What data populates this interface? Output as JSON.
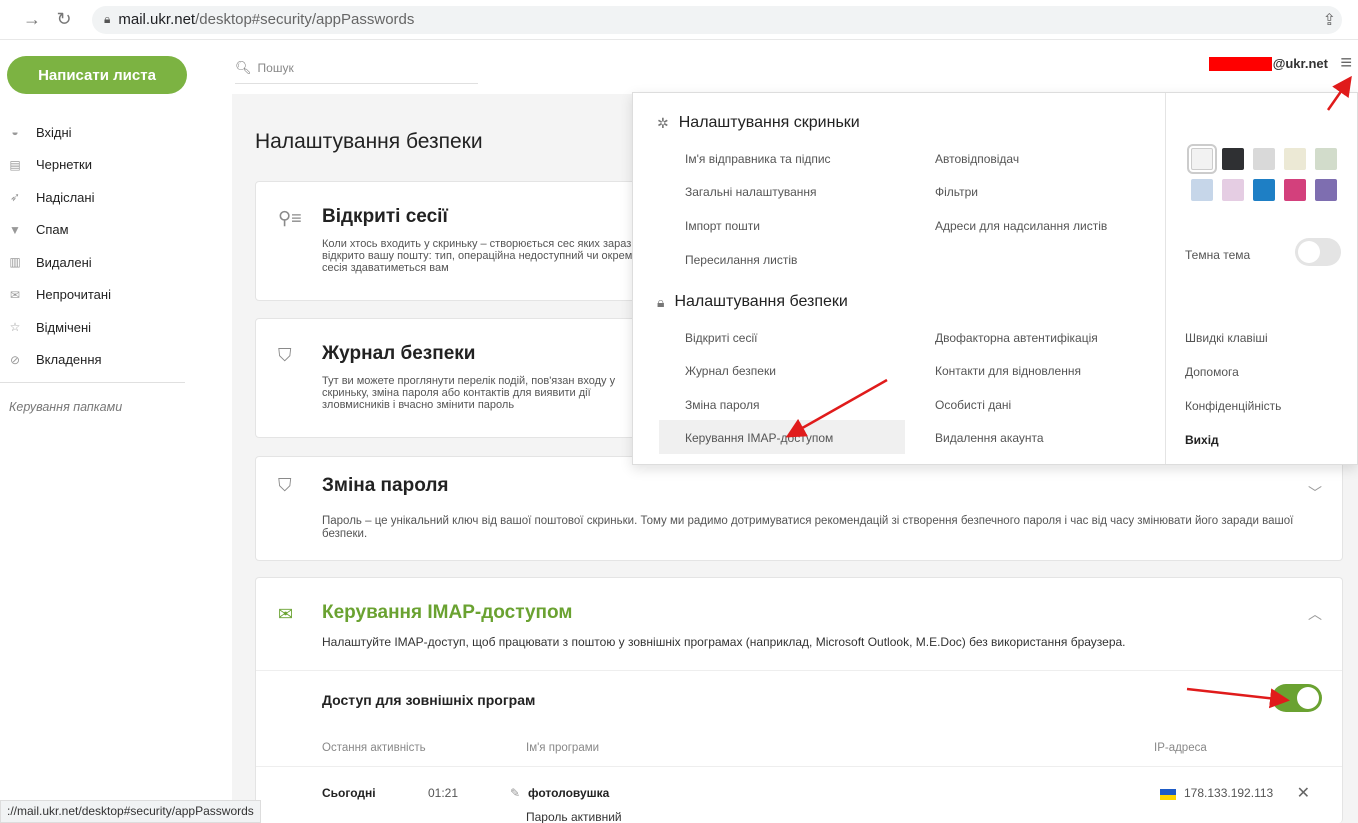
{
  "browser": {
    "url_host": "mail.ukr.net",
    "url_path": "/desktop#security/appPasswords",
    "status_url": "://mail.ukr.net/desktop#security/appPasswords"
  },
  "sidebar": {
    "compose_label": "Написати листа",
    "folders": [
      {
        "label": "Вхідні",
        "icon": "inbox-icon"
      },
      {
        "label": "Чернетки",
        "icon": "drafts-icon"
      },
      {
        "label": "Надіслані",
        "icon": "sent-icon"
      },
      {
        "label": "Спам",
        "icon": "spam-icon"
      },
      {
        "label": "Видалені",
        "icon": "trash-icon"
      },
      {
        "label": "Непрочитані",
        "icon": "unread-icon"
      },
      {
        "label": "Відмічені",
        "icon": "star-icon"
      },
      {
        "label": "Вкладення",
        "icon": "attachment-icon"
      }
    ],
    "manage_folders": "Керування папками"
  },
  "search": {
    "placeholder": "Пошук"
  },
  "account": {
    "email_suffix": "@ukr.net"
  },
  "page": {
    "title": "Налаштування безпеки",
    "sessions": {
      "title": "Відкриті сесії",
      "desc": "Коли хтось входить у скриньку – створюється сес яких зараз відкрито вашу пошту: тип, операційна недоступний чи окрема сесія здаватиметься вам"
    },
    "journal": {
      "title": "Журнал безпеки",
      "desc": "Тут ви можете проглянути перелік подій, пов'язан входу у скриньку, зміна пароля або контактів для виявити дії зловмисників і вчасно змінити пароль"
    },
    "password": {
      "title": "Зміна пароля",
      "desc": "Пароль – це унікальний ключ від вашої поштової скриньки. Тому ми радимо дотримуватися рекомендацій зі створення безпечного пароля і час від часу змінювати його заради вашої безпеки."
    },
    "imap": {
      "title": "Керування IMAP-доступом",
      "desc": "Налаштуйте IMAP-доступ, щоб працювати з поштою у зовнішніх програмах (наприклад, Microsoft Outlook, M.E.Doc) без використання браузера.",
      "access_label": "Доступ для зовнішніх програм",
      "access_enabled": true,
      "columns": {
        "last_activity": "Остання активність",
        "app_name": "Ім'я програми",
        "ip": "IP-адреса"
      },
      "rows": [
        {
          "day": "Сьогодні",
          "time": "01:21",
          "app": "фотоловушка",
          "status": "Пароль активний",
          "ip": "178.133.192.113"
        }
      ]
    }
  },
  "menu": {
    "mailbox_header": "Налаштування скриньки",
    "mailbox_left": [
      "Ім'я відправника та підпис",
      "Загальні налаштування",
      "Імпорт пошти",
      "Пересилання листів"
    ],
    "mailbox_right": [
      "Автовідповідач",
      "Фільтри",
      "Адреси для надсилання листів"
    ],
    "security_header": "Налаштування безпеки",
    "security_left": [
      "Відкриті сесії",
      "Журнал безпеки",
      "Зміна пароля",
      "Керування IMAP-доступом"
    ],
    "security_right": [
      "Двофакторна автентифікація",
      "Контакти для відновлення",
      "Особисті дані",
      "Видалення акаунта"
    ],
    "theme_colors": [
      "#f2f2f2",
      "#2f3033",
      "#d9d9d9",
      "#ece9d5",
      "#d2dccb",
      "#c6d6e9",
      "#e5cde3",
      "#1e7fc5",
      "#d3407c",
      "#7e6eb0"
    ],
    "dark_theme_label": "Темна тема",
    "dark_theme_enabled": false,
    "links": [
      "Швидкі клавіші",
      "Допомога",
      "Конфіденційність"
    ],
    "exit_label": "Вихід"
  }
}
